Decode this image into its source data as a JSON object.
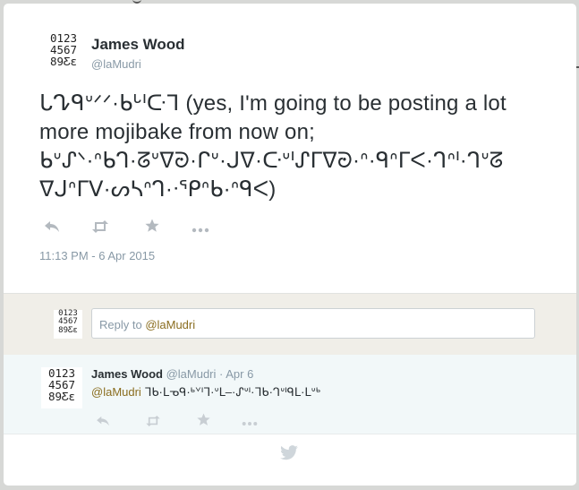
{
  "tweet": {
    "author_name": "James Wood",
    "author_handle": "@laMudri",
    "avatar_text": [
      "0123",
      "4567",
      "89Ƹε"
    ],
    "text": "ᒐᖊᑫᐡᐟᐟ·ᑲᒡᑊᑢᒣ (yes, I'm going to be posting a lot more mojibake from now on; ᑲᐡᔑᐠ·ᐢᑲᒉ·ᘔᐡᐁᘒ·ᒋᐡ·ᒍᐁ·ᑢᐡᑊᔑᒥᐁᘒ·ᐢ·ᑫᐢᒥᐸ·ᒉᐢᑊ·ᒉᐡᘔ ᐁᒍᐢᒥᐯ·ᔕᓴᐢᒉ·ᐧᕿᐢᑲ·ᐢᑫᐸ)",
    "timestamp": "11:13 PM - 6 Apr 2015",
    "actions": [
      "reply-icon",
      "retweet-icon",
      "favorite-icon",
      "more-icon"
    ]
  },
  "reply_box": {
    "avatar_text": [
      "0123",
      "4567",
      "89Ƹε"
    ],
    "placeholder_prefix": "Reply to ",
    "placeholder_mention": "@laMudri"
  },
  "reply_tweet": {
    "author_name": "James Wood",
    "meta": "@laMudri · Apr 6",
    "avatar_text": [
      "0123",
      "4567",
      "89Ƹε"
    ],
    "mention": "@laMudri",
    "text": " ᒣᑲ·ᒪᓀᑫ·ᒃᘁᑊᒣ·ᐡᒪ–·ᔑᐡᑊ·ᒣᑲ·ᒉᐡᑊᑫᒪ·ᒪᐡᒃ",
    "actions": [
      "reply-icon",
      "retweet-icon",
      "favorite-icon",
      "more-icon"
    ]
  },
  "footer": {
    "icon": "twitter-bird-icon"
  }
}
